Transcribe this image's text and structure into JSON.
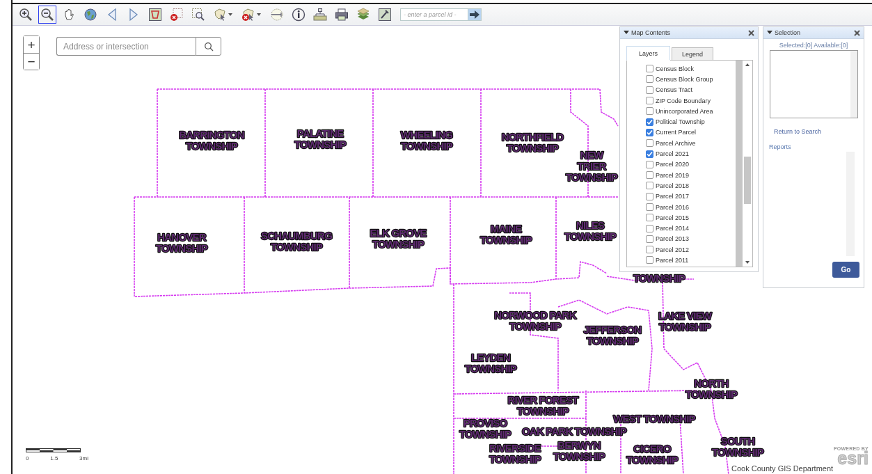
{
  "toolbar": {
    "tools": [
      {
        "kind": "zoom-in",
        "selected": false
      },
      {
        "kind": "zoom-out",
        "selected": true
      },
      {
        "kind": "pan",
        "selected": false
      },
      {
        "kind": "globe",
        "selected": false
      },
      {
        "kind": "back",
        "selected": false
      },
      {
        "kind": "forward",
        "selected": false
      },
      {
        "kind": "extent",
        "selected": false
      },
      {
        "kind": "clear",
        "selected": false
      },
      {
        "kind": "zoom-selection",
        "selected": false
      },
      {
        "kind": "select-shape",
        "selected": false
      },
      {
        "kind": "remove-shape",
        "selected": false
      },
      {
        "kind": "measure",
        "selected": false
      },
      {
        "kind": "info",
        "selected": false
      },
      {
        "kind": "network",
        "selected": false
      },
      {
        "kind": "print",
        "selected": false
      },
      {
        "kind": "layers",
        "selected": false
      },
      {
        "kind": "tools",
        "selected": false
      }
    ],
    "parcel_search": {
      "placeholder": "- enter a parcel id -"
    }
  },
  "map": {
    "zoom_in": "+",
    "zoom_out": "−",
    "search": {
      "placeholder": "Address or intersection"
    },
    "labels": [
      {
        "lines": [
          "BARRINGTON",
          "TOWNSHIP"
        ]
      },
      {
        "lines": [
          "PALATINE",
          "TOWNSHIP"
        ]
      },
      {
        "lines": [
          "WHEELING",
          "TOWNSHIP"
        ]
      },
      {
        "lines": [
          "NORTHFIELD",
          "TOWNSHIP"
        ]
      },
      {
        "lines": [
          "NEW",
          "TRIER",
          "TOWNSHIP"
        ]
      },
      {
        "lines": [
          "HANOVER",
          "TOWNSHIP"
        ]
      },
      {
        "lines": [
          "SCHAUMBURG",
          "TOWNSHIP"
        ]
      },
      {
        "lines": [
          "ELK GROVE",
          "TOWNSHIP"
        ]
      },
      {
        "lines": [
          "MAINE",
          "TOWNSHIP"
        ]
      },
      {
        "lines": [
          "NILES",
          "TOWNSHIP"
        ]
      },
      {
        "lines": [
          "TOWNSHIP"
        ]
      },
      {
        "lines": [
          "NORWOOD PARK",
          "TOWNSHIP"
        ]
      },
      {
        "lines": [
          "JEFFERSON",
          "TOWNSHIP"
        ]
      },
      {
        "lines": [
          "LAKE VIEW",
          "TOWNSHIP"
        ]
      },
      {
        "lines": [
          "LEYDEN",
          "TOWNSHIP"
        ]
      },
      {
        "lines": [
          "NORTH",
          "TOWNSHIP"
        ]
      },
      {
        "lines": [
          "RIVER FOREST",
          "TOWNSHIP"
        ]
      },
      {
        "lines": [
          "PROVISO",
          "TOWNSHIP"
        ]
      },
      {
        "lines": [
          "WEST TOWNSHIP"
        ]
      },
      {
        "lines": [
          "OAK PARK TOWNSHIP"
        ]
      },
      {
        "lines": [
          "RIVERSIDE",
          "TOWNSHIP"
        ]
      },
      {
        "lines": [
          "BERWYN",
          "TOWNSHIP"
        ]
      },
      {
        "lines": [
          "CICERO",
          "TOWNSHIP"
        ]
      },
      {
        "lines": [
          "SOUTH",
          "TOWNSHIP"
        ]
      }
    ],
    "scale": {
      "ticks": [
        "0",
        "1.5",
        "3mi"
      ]
    },
    "attribution": "Cook County GIS Department",
    "logo": {
      "tagline": "POWERED BY",
      "name": "esri"
    }
  },
  "map_contents": {
    "title": "Map Contents",
    "tabs": [
      {
        "label": "Layers",
        "selected": true
      },
      {
        "label": "Legend",
        "selected": false
      }
    ],
    "layers": [
      {
        "label": "Census Block",
        "checked": false
      },
      {
        "label": "Census Block Group",
        "checked": false
      },
      {
        "label": "Census Tract",
        "checked": false
      },
      {
        "label": "ZIP Code Boundary",
        "checked": false
      },
      {
        "label": "Unincorporated Area",
        "checked": false
      },
      {
        "label": "Political Township",
        "checked": true
      },
      {
        "label": "Current Parcel",
        "checked": true
      },
      {
        "label": "Parcel Archive",
        "checked": false
      },
      {
        "label": "Parcel 2021",
        "checked": true
      },
      {
        "label": "Parcel 2020",
        "checked": false
      },
      {
        "label": "Parcel 2019",
        "checked": false
      },
      {
        "label": "Parcel 2018",
        "checked": false
      },
      {
        "label": "Parcel 2017",
        "checked": false
      },
      {
        "label": "Parcel 2016",
        "checked": false
      },
      {
        "label": "Parcel 2015",
        "checked": false
      },
      {
        "label": "Parcel 2014",
        "checked": false
      },
      {
        "label": "Parcel 2013",
        "checked": false
      },
      {
        "label": "Parcel 2012",
        "checked": false
      },
      {
        "label": "Parcel 2011",
        "checked": false
      }
    ]
  },
  "selection": {
    "title": "Selection",
    "summary": "Selected:[0] Available:[0]",
    "return_link": "Return to Search",
    "reports": "Reports",
    "go": "Go"
  }
}
